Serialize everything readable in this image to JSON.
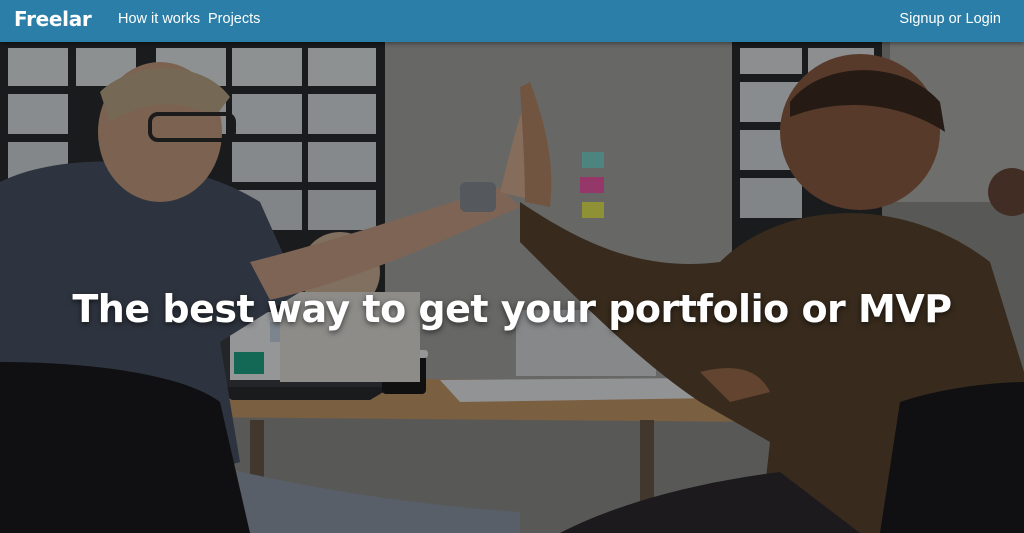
{
  "navbar": {
    "brand": "Freelar",
    "links": [
      {
        "label": "How it works"
      },
      {
        "label": "Projects"
      }
    ],
    "auth_label": "Signup or Login",
    "background_color": "#2a7ea8"
  },
  "hero": {
    "headline": "The best way to get your portfolio or MVP",
    "image_description": "two people giving a high five at an office table"
  },
  "icons": {
    "photo": "hero-photo"
  }
}
